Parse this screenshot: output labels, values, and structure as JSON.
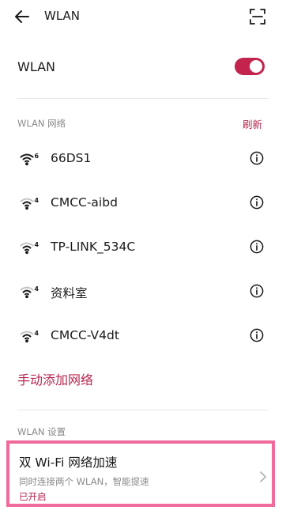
{
  "colors": {
    "accent": "#b7264f",
    "toggle_on": "#c2244e",
    "highlight_border": "#f06a9b",
    "icon": "#1a1a1a"
  },
  "header": {
    "title": "WLAN",
    "back_icon": "arrow-left-icon",
    "scan_icon": "scan-icon"
  },
  "wlan_toggle": {
    "label": "WLAN",
    "state": "on"
  },
  "networks_section": {
    "title": "WLAN 网络",
    "refresh_label": "刷新",
    "networks": [
      {
        "name": "66DS1",
        "wifi_badge": "6",
        "signal_level": 3,
        "info_icon": "info-icon"
      },
      {
        "name": "CMCC-aibd",
        "wifi_badge": "4",
        "signal_level": 2,
        "info_icon": "info-icon"
      },
      {
        "name": "TP-LINK_534C",
        "wifi_badge": "4",
        "signal_level": 2,
        "info_icon": "info-icon"
      },
      {
        "name": "资料室",
        "wifi_badge": "4",
        "signal_level": 2,
        "info_icon": "info-icon"
      },
      {
        "name": "CMCC-V4dt",
        "wifi_badge": "4",
        "signal_level": 2,
        "info_icon": "info-icon"
      }
    ],
    "add_network_label": "手动添加网络"
  },
  "settings_section": {
    "title": "WLAN 设置",
    "dual_wifi": {
      "title": "双 Wi-Fi 网络加速",
      "description": "同时连接两个 WLAN，智能提速",
      "status": "已开启",
      "chevron_icon": "chevron-right-icon"
    }
  }
}
